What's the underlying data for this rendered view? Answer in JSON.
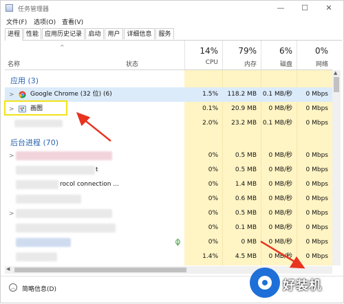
{
  "window": {
    "title": "任务管理器",
    "minimize": "—",
    "maximize": "☐",
    "close": "✕"
  },
  "menu": [
    "文件(F)",
    "选项(O)",
    "查看(V)"
  ],
  "tabs": [
    "进程",
    "性能",
    "应用历史记录",
    "启动",
    "用户",
    "详细信息",
    "服务"
  ],
  "header": {
    "sort_caret": "^",
    "name": "名称",
    "status": "状态",
    "cpu_pct": "14%",
    "cpu": "CPU",
    "mem_pct": "79%",
    "mem": "内存",
    "disk_pct": "6%",
    "disk": "磁盘",
    "net_pct": "0%",
    "net": "网络"
  },
  "groups": {
    "apps": "应用 (3)",
    "background": "后台进程 (70)"
  },
  "app_rows": [
    {
      "name": "Google Chrome (32 位) (6)",
      "cpu": "1.5%",
      "mem": "118.2 MB",
      "disk": "0.1 MB/秒",
      "net": "0 Mbps"
    },
    {
      "name": "画图",
      "cpu": "0.1%",
      "mem": "20.9 MB",
      "disk": "0 MB/秒",
      "net": "0 Mbps"
    },
    {
      "name": "",
      "cpu": "2.0%",
      "mem": "23.2 MB",
      "disk": "0.1 MB/秒",
      "net": "0 Mbps"
    }
  ],
  "bg_rows": [
    {
      "name": "",
      "cpu": "0%",
      "mem": "0.5 MB",
      "disk": "0 MB/秒",
      "net": "0 Mbps"
    },
    {
      "name": "t",
      "cpu": "0%",
      "mem": "0.5 MB",
      "disk": "0 MB/秒",
      "net": "0 Mbps"
    },
    {
      "name": "rocol connection ...",
      "cpu": "0%",
      "mem": "1.4 MB",
      "disk": "0 MB/秒",
      "net": "0 Mbps"
    },
    {
      "name": "",
      "cpu": "0%",
      "mem": "0.6 MB",
      "disk": "0 MB/秒",
      "net": "0 Mbps"
    },
    {
      "name": "",
      "cpu": "0%",
      "mem": "0.5 MB",
      "disk": "0 MB/秒",
      "net": "0 Mbps"
    },
    {
      "name": "",
      "cpu": "0%",
      "mem": "0.1 MB",
      "disk": "0 MB/秒",
      "net": "0 Mbps"
    },
    {
      "name": "",
      "cpu": "0%",
      "mem": "0 MB",
      "disk": "0 MB/秒",
      "net": "0 Mbps"
    },
    {
      "name": "",
      "cpu": "1.4%",
      "mem": "4.5 MB",
      "disk": "0 MB/秒",
      "net": "0 Mbps"
    }
  ],
  "footer": {
    "fewer_details": "简略信息(D)",
    "fewer_icon": "chevron-up-icon"
  },
  "watermark": {
    "text": "好装机"
  },
  "colors": {
    "highlight": "#fff4c4",
    "selected": "#dcebfa",
    "group": "#2a64b0",
    "annotation_box": "#f2e21a",
    "annotation_arrow": "#e8331f"
  }
}
